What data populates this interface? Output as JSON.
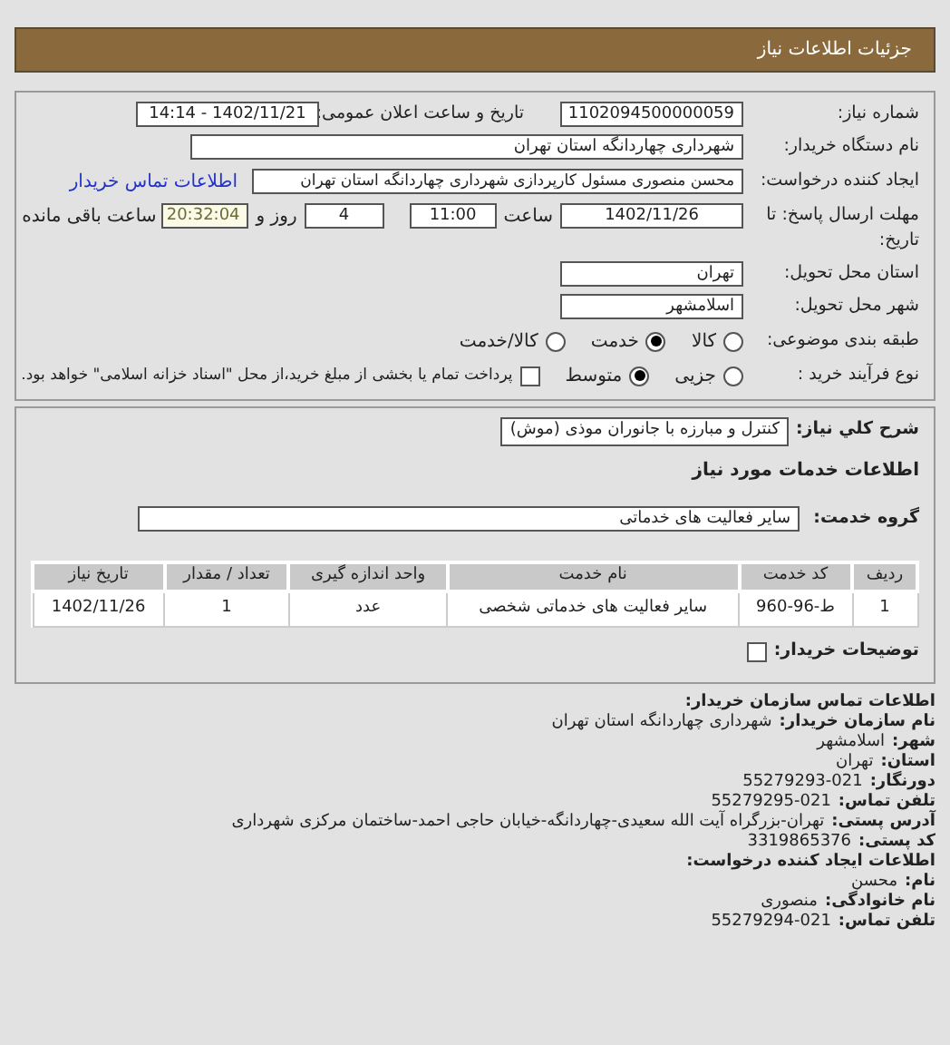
{
  "header": {
    "title": "جزئیات اطلاعات نیاز"
  },
  "need_number": {
    "label": "شماره نیاز:",
    "value": "1102094500000059"
  },
  "announce": {
    "label": "تاریخ و ساعت اعلان عمومی:",
    "value": "1402/11/21 - 14:14"
  },
  "buyer_org": {
    "label": "نام دستگاه خریدار:",
    "value": "شهرداری چهاردانگه استان تهران"
  },
  "requester": {
    "label": "ایجاد کننده درخواست:",
    "value": "محسن منصوری مسئول کارپردازی شهرداری چهاردانگه استان تهران",
    "link": "اطلاعات تماس خریدار"
  },
  "deadline": {
    "label": "مهلت ارسال پاسخ: تا تاریخ:",
    "date": "1402/11/26",
    "time_label": "ساعت",
    "time": "11:00",
    "days": "4",
    "days_label": "روز و",
    "remaining": "20:32:04",
    "remaining_label": "ساعت باقی مانده"
  },
  "province": {
    "label": "استان محل تحویل:",
    "value": "تهران"
  },
  "city": {
    "label": "شهر محل تحویل:",
    "value": "اسلامشهر"
  },
  "category": {
    "label": "طبقه بندی موضوعی:",
    "options": [
      {
        "label": "کالا",
        "selected": false
      },
      {
        "label": "خدمت",
        "selected": true
      },
      {
        "label": "کالا/خدمت",
        "selected": false
      }
    ]
  },
  "process": {
    "label": "نوع فرآیند خرید :",
    "options": [
      {
        "label": "جزیی",
        "selected": false
      },
      {
        "label": "متوسط",
        "selected": true
      }
    ],
    "payment": {
      "checked": false,
      "text": "پرداخت تمام یا بخشی از مبلغ خرید،از محل \"اسناد خزانه اسلامی\" خواهد بود."
    }
  },
  "description": {
    "label": "شرح کلي نياز:",
    "value": "کنترل و مبارزه با جانوران موذی (موش)"
  },
  "services_heading": "اطلاعات خدمات مورد نیاز",
  "service_group": {
    "label": "گروه خدمت:",
    "value": "سایر فعالیت های خدماتی"
  },
  "table": {
    "columns": [
      "ردیف",
      "کد خدمت",
      "نام خدمت",
      "واحد اندازه گیری",
      "تعداد / مقدار",
      "تاریخ نیاز"
    ],
    "rows": [
      [
        "1",
        "ط-96-960",
        "سایر فعالیت های خدماتی شخصی",
        "عدد",
        "1",
        "1402/11/26"
      ]
    ]
  },
  "buyer_notes": {
    "label": "توضیحات خریدار:",
    "checked": false
  },
  "contact": {
    "heading": "اطلاعات تماس سازمان خریدار:",
    "lines": [
      {
        "label": "نام سازمان خریدار:",
        "value": "شهرداری چهاردانگه استان تهران"
      },
      {
        "label": "شهر:",
        "value": "اسلامشهر"
      },
      {
        "label": "استان:",
        "value": "تهران"
      },
      {
        "label": "دورنگار:",
        "value": "55279293-021"
      },
      {
        "label": "تلفن تماس:",
        "value": "55279295-021"
      },
      {
        "label": "آدرس پستی:",
        "value": "تهران-بزرگراه آیت الله سعیدی-چهاردانگه-خیابان حاجی احمد-ساختمان مرکزی شهرداری"
      },
      {
        "label": "کد پستی:",
        "value": "3319865376"
      }
    ]
  },
  "creator": {
    "heading": "اطلاعات ایجاد کننده درخواست:",
    "lines": [
      {
        "label": "نام:",
        "value": "محسن"
      },
      {
        "label": "نام خانوادگی:",
        "value": "منصوری"
      },
      {
        "label": "تلفن تماس:",
        "value": "55279294-021"
      }
    ]
  }
}
